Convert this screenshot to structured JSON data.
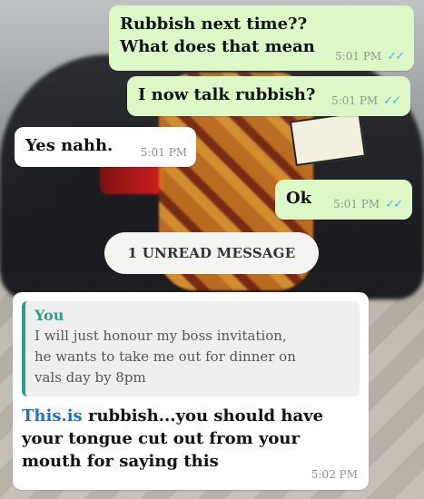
{
  "messages": [
    {
      "direction": "outgoing",
      "text": "Rubbish next time??\nWhat does that mean",
      "time": "5:01 PM",
      "status": "read"
    },
    {
      "direction": "outgoing",
      "text": "I now talk rubbish?",
      "time": "5:01 PM",
      "status": "read"
    },
    {
      "direction": "incoming",
      "text": "Yes nahh.",
      "time": "5:01 PM"
    },
    {
      "direction": "outgoing",
      "text": "Ok",
      "time": "5:01 PM",
      "status": "read"
    }
  ],
  "unread_label": "1 UNREAD MESSAGE",
  "reply_message": {
    "quote_author": "You",
    "quote_text": "I will just honour my boss invitation,\nhe wants to take me out for dinner on\nvals day by 8pm",
    "link_text": "This.is",
    "text": " rubbish...you should have\nyour tongue cut out from your\nmouth for saying this",
    "time": "5:02 PM"
  },
  "icons": {
    "read_receipt": "double-check-icon"
  },
  "colors": {
    "outgoing_bubble": "#dcf8c6",
    "incoming_bubble": "#ffffff",
    "read_tick": "#4fb3e8",
    "quote_accent": "#2f9e89",
    "link": "#1a73c9"
  }
}
